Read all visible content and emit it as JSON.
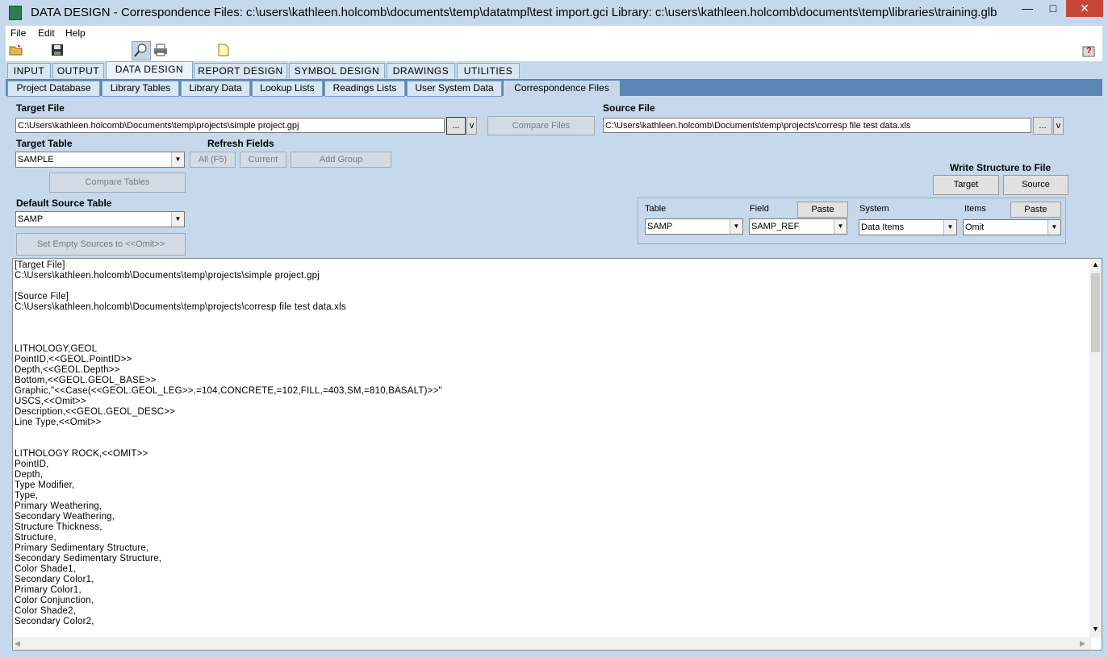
{
  "window": {
    "title": "DATA DESIGN -  Correspondence Files:  c:\\users\\kathleen.holcomb\\documents\\temp\\datatmpl\\test import.gci  Library: c:\\users\\kathleen.holcomb\\documents\\temp\\libraries\\training.glb",
    "minimize": "—",
    "maximize": "□",
    "close": "✕"
  },
  "menu": {
    "file": "File",
    "edit": "Edit",
    "help": "Help"
  },
  "main_tabs": [
    "INPUT",
    "OUTPUT",
    "DATA DESIGN",
    "REPORT DESIGN",
    "SYMBOL DESIGN",
    "DRAWINGS",
    "UTILITIES"
  ],
  "sub_tabs": [
    "Project Database",
    "Library Tables",
    "Library Data",
    "Lookup Lists",
    "Readings Lists",
    "User System Data",
    "Correspondence Files"
  ],
  "target_file": {
    "label": "Target File",
    "value": "C:\\Users\\kathleen.holcomb\\Documents\\temp\\projects\\simple project.gpj",
    "browse": "...",
    "dropdown": "v"
  },
  "compare_files": "Compare Files",
  "source_file": {
    "label": "Source File",
    "value": "C:\\Users\\kathleen.holcomb\\Documents\\temp\\projects\\corresp file test data.xls",
    "browse": "...",
    "dropdown": "v"
  },
  "target_table": {
    "label": "Target Table",
    "value": "SAMPLE"
  },
  "refresh_fields": {
    "label": "Refresh Fields",
    "all": "All (F5)",
    "current": "Current",
    "add_group": "Add Group"
  },
  "compare_tables": "Compare Tables",
  "default_source_table": {
    "label": "Default Source Table",
    "value": "SAMP"
  },
  "set_empty_sources": "Set Empty Sources to <<Omit>>",
  "write_structure": {
    "label": "Write Structure to File",
    "target": "Target",
    "source": "Source"
  },
  "paste_group": {
    "table_label": "Table",
    "table_value": "SAMP",
    "field_label": "Field",
    "field_value": "SAMP_REF",
    "field_paste": "Paste",
    "system_label": "System",
    "system_value": "Data Items",
    "items_label": "Items",
    "items_value": "Omit",
    "items_paste": "Paste"
  },
  "editor_lines": [
    "[Target File]",
    "C:\\Users\\kathleen.holcomb\\Documents\\temp\\projects\\simple project.gpj",
    "",
    "[Source File]",
    "C:\\Users\\kathleen.holcomb\\Documents\\temp\\projects\\corresp file test data.xls",
    "",
    "",
    "",
    "LITHOLOGY,GEOL",
    "PointID,<<GEOL.PointID>>",
    "Depth,<<GEOL.Depth>>",
    "Bottom,<<GEOL.GEOL_BASE>>",
    "Graphic,\"<<Case(<<GEOL.GEOL_LEG>>,=104,CONCRETE,=102,FILL,=403,SM,=810,BASALT)>>\"",
    "USCS,<<Omit>>",
    "Description,<<GEOL.GEOL_DESC>>",
    "Line Type,<<Omit>>",
    "",
    "",
    "LITHOLOGY ROCK,<<OMIT>>",
    "PointID,",
    "Depth,",
    "Type Modifier,",
    "Type,",
    "Primary Weathering,",
    "Secondary Weathering,",
    "Structure Thickness,",
    "Structure,",
    "Primary Sedimentary Structure,",
    "Secondary Sedimentary Structure,",
    "Color Shade1,",
    "Secondary Color1,",
    "Primary Color1,",
    "Color Conjunction,",
    "Color Shade2,",
    "Secondary Color2,"
  ]
}
